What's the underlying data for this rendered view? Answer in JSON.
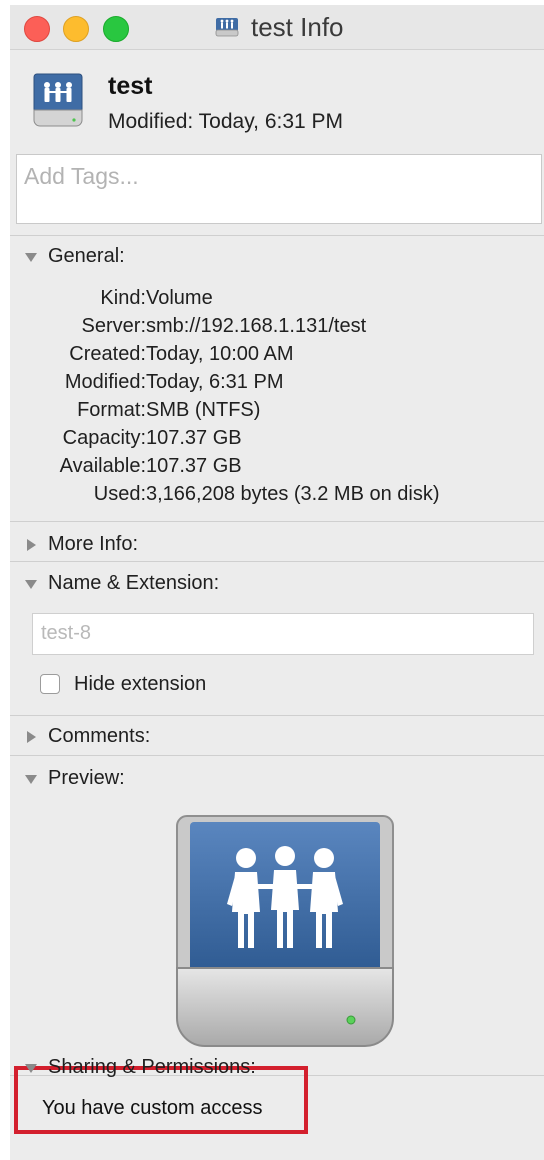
{
  "window": {
    "title": "test Info",
    "traffic_lights": [
      "close",
      "minimize",
      "zoom"
    ]
  },
  "header": {
    "name": "test",
    "modified": "Modified: Today, 6:31 PM",
    "tags_placeholder": "Add Tags..."
  },
  "sections": {
    "general": {
      "label": "General:",
      "expanded": true
    },
    "more_info": {
      "label": "More Info:",
      "expanded": false
    },
    "name_extension": {
      "label": "Name & Extension:",
      "expanded": true
    },
    "comments": {
      "label": "Comments:",
      "expanded": false
    },
    "preview": {
      "label": "Preview:",
      "expanded": true
    },
    "sharing": {
      "label": "Sharing & Permissions:",
      "expanded": true
    }
  },
  "general": {
    "rows": [
      {
        "key": "Kind:",
        "value": "Volume"
      },
      {
        "key": "Server:",
        "value": "smb://192.168.1.131/test"
      },
      {
        "key": "Created:",
        "value": "Today, 10:00 AM"
      },
      {
        "key": "Modified:",
        "value": "Today, 6:31 PM"
      },
      {
        "key": "Format:",
        "value": "SMB (NTFS)"
      },
      {
        "key": "Capacity:",
        "value": "107.37 GB"
      },
      {
        "key": "Available:",
        "value": "107.37 GB"
      },
      {
        "key": "Used:",
        "value": "3,166,208 bytes (3.2 MB on disk)"
      }
    ]
  },
  "name_extension": {
    "field_value": "test-8",
    "hide_extension_label": "Hide extension",
    "hide_extension_checked": false
  },
  "sharing": {
    "access_text": "You have custom access"
  },
  "colors": {
    "close": "#fc5f57",
    "minimize": "#fdbc2e",
    "zoom": "#29c740",
    "highlight": "#d31f2d",
    "drive_blue": "#3f6ca5"
  },
  "icons": {
    "title_icon": "shared-drive-icon",
    "header_icon": "shared-drive-icon",
    "preview_icon": "shared-drive-icon"
  }
}
